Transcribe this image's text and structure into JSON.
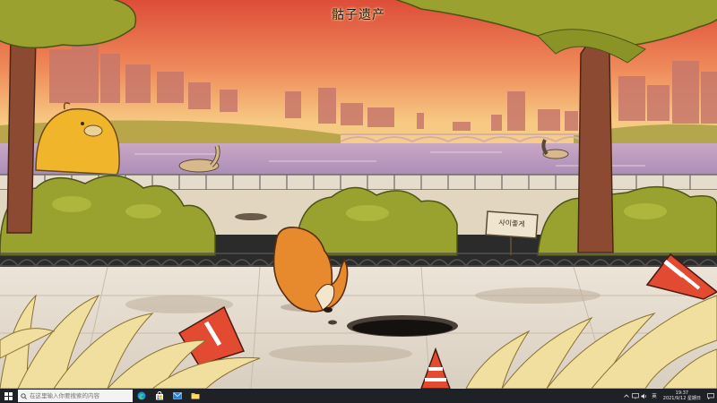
{
  "wallpaper": {
    "caption": "骷子遗产",
    "sign_text": "사이좋게"
  },
  "taskbar": {
    "search_placeholder": "在这里输入你要搜索的内容",
    "apps": [
      "edge-icon",
      "store-icon",
      "mail-icon",
      "file-explorer-icon"
    ],
    "ime_label": "英",
    "time": "19:37",
    "date": "2021/9/12 星期日"
  },
  "colors": {
    "sky_top": "#e0553d",
    "sky_bottom": "#f5c87a",
    "taskbar": "#1e2227",
    "foliage": "#8f9a2c"
  }
}
